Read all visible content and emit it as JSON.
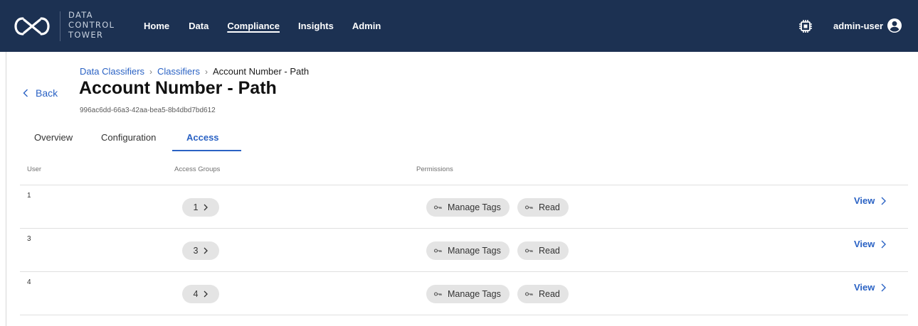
{
  "brand": {
    "logo_icon": "infinity-logo-icon",
    "lines": [
      "DATA",
      "CONTROL",
      "TOWER"
    ]
  },
  "nav": {
    "items": [
      {
        "label": "Home"
      },
      {
        "label": "Data"
      },
      {
        "label": "Compliance",
        "active": true
      },
      {
        "label": "Insights"
      },
      {
        "label": "Admin"
      }
    ]
  },
  "header_right": {
    "chip_icon": "chip-icon",
    "user_name": "admin-user",
    "user_icon": "account-circle-icon"
  },
  "back_label": "Back",
  "breadcrumb": {
    "items": [
      "Data Classifiers",
      "Classifiers",
      "Account Number - Path"
    ],
    "separator": "›"
  },
  "page": {
    "title": "Account Number - Path",
    "id": "996ac6dd-66a3-42aa-bea5-8b4dbd7bd612"
  },
  "tabs": [
    {
      "label": "Overview"
    },
    {
      "label": "Configuration"
    },
    {
      "label": "Access",
      "active": true
    }
  ],
  "table": {
    "headers": [
      "User",
      "Access Groups",
      "Permissions"
    ],
    "rows": [
      {
        "user": "1",
        "groups": "1",
        "permissions": [
          "Manage Tags",
          "Read"
        ],
        "action": "View"
      },
      {
        "user": "3",
        "groups": "3",
        "permissions": [
          "Manage Tags",
          "Read"
        ],
        "action": "View"
      },
      {
        "user": "4",
        "groups": "4",
        "permissions": [
          "Manage Tags",
          "Read"
        ],
        "action": "View"
      }
    ]
  },
  "colors": {
    "nav_bg": "#1c3152",
    "link": "#2a62c4",
    "pill_bg": "#e4e4e4"
  }
}
